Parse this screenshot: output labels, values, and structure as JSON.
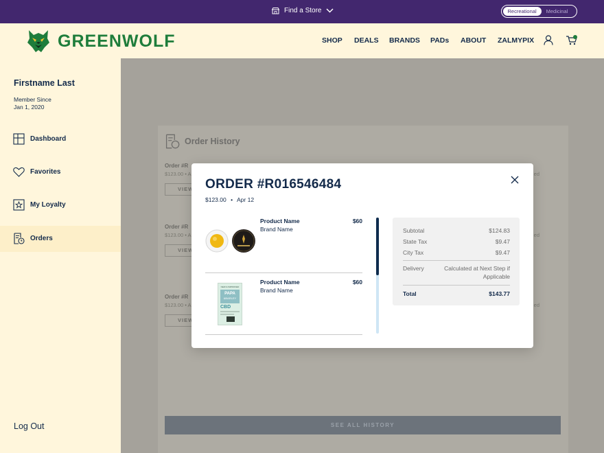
{
  "topbar": {
    "find_store": "Find a Store",
    "toggle": {
      "option_1": "Recreational",
      "option_2": "Medicinal",
      "active": "Recreational"
    }
  },
  "header": {
    "brand": "GREENWOLF",
    "nav": [
      "SHOP",
      "DEALS",
      "BRANDS",
      "PADs",
      "ABOUT",
      "ZALMYPIX"
    ],
    "icons": [
      "user-icon",
      "cart-icon"
    ]
  },
  "sidebar": {
    "user_name": "Firstname Last",
    "member_since_label": "Member Since",
    "member_since_date": "Jan 1, 2020",
    "items": [
      {
        "label": "Dashboard",
        "icon": "dashboard-icon"
      },
      {
        "label": "Favorites",
        "icon": "heart-icon"
      },
      {
        "label": "My Loyalty",
        "icon": "loyalty-star-icon"
      },
      {
        "label": "Orders",
        "icon": "orders-icon"
      }
    ],
    "active_item": "Orders",
    "logout": "Log Out"
  },
  "order_history": {
    "title": "Order History",
    "orders": [
      {
        "id": "Order #R",
        "meta": "$123.00 • A",
        "view": "VIEW",
        "right": "ed"
      },
      {
        "id": "Order #R",
        "meta": "$123.00 • A",
        "view": "VIEW",
        "right": "ed"
      },
      {
        "id": "Order #R",
        "meta": "$123.00 • A",
        "view": "VIEW",
        "right": "ed"
      }
    ],
    "see_all": "SEE ALL HISTORY"
  },
  "modal": {
    "title": "ORDER #R016546484",
    "total": "$123.00",
    "separator": "•",
    "date": "Apr 12",
    "products": [
      {
        "name": "Product Name",
        "brand": "Brand Name",
        "price": "$60",
        "image": "concentrate-jars"
      },
      {
        "name": "Product Name",
        "brand": "Brand Name",
        "price": "$60",
        "image": "papa-barkley-cbd-box"
      }
    ],
    "summary": {
      "subtotal_label": "Subtotal",
      "subtotal": "$124.83",
      "state_tax_label": "State Tax",
      "state_tax": "$9.47",
      "city_tax_label": "City Tax",
      "city_tax": "$9.47",
      "delivery_label": "Delivery",
      "delivery_line1": "Calculated at Next Step if",
      "delivery_line2": "Applicable",
      "total_label": "Total",
      "total": "$143.77"
    },
    "product_box_text": {
      "top": "NEW & IMPROVED",
      "brand_line1": "PAPA",
      "brand_line2": "&BARLEY",
      "cbd": "CBD"
    },
    "colors": {
      "brand_green": "#1e7d3b",
      "topbar_purple": "#42276e",
      "navy": "#132a4a",
      "cream": "#fff6dc"
    }
  }
}
